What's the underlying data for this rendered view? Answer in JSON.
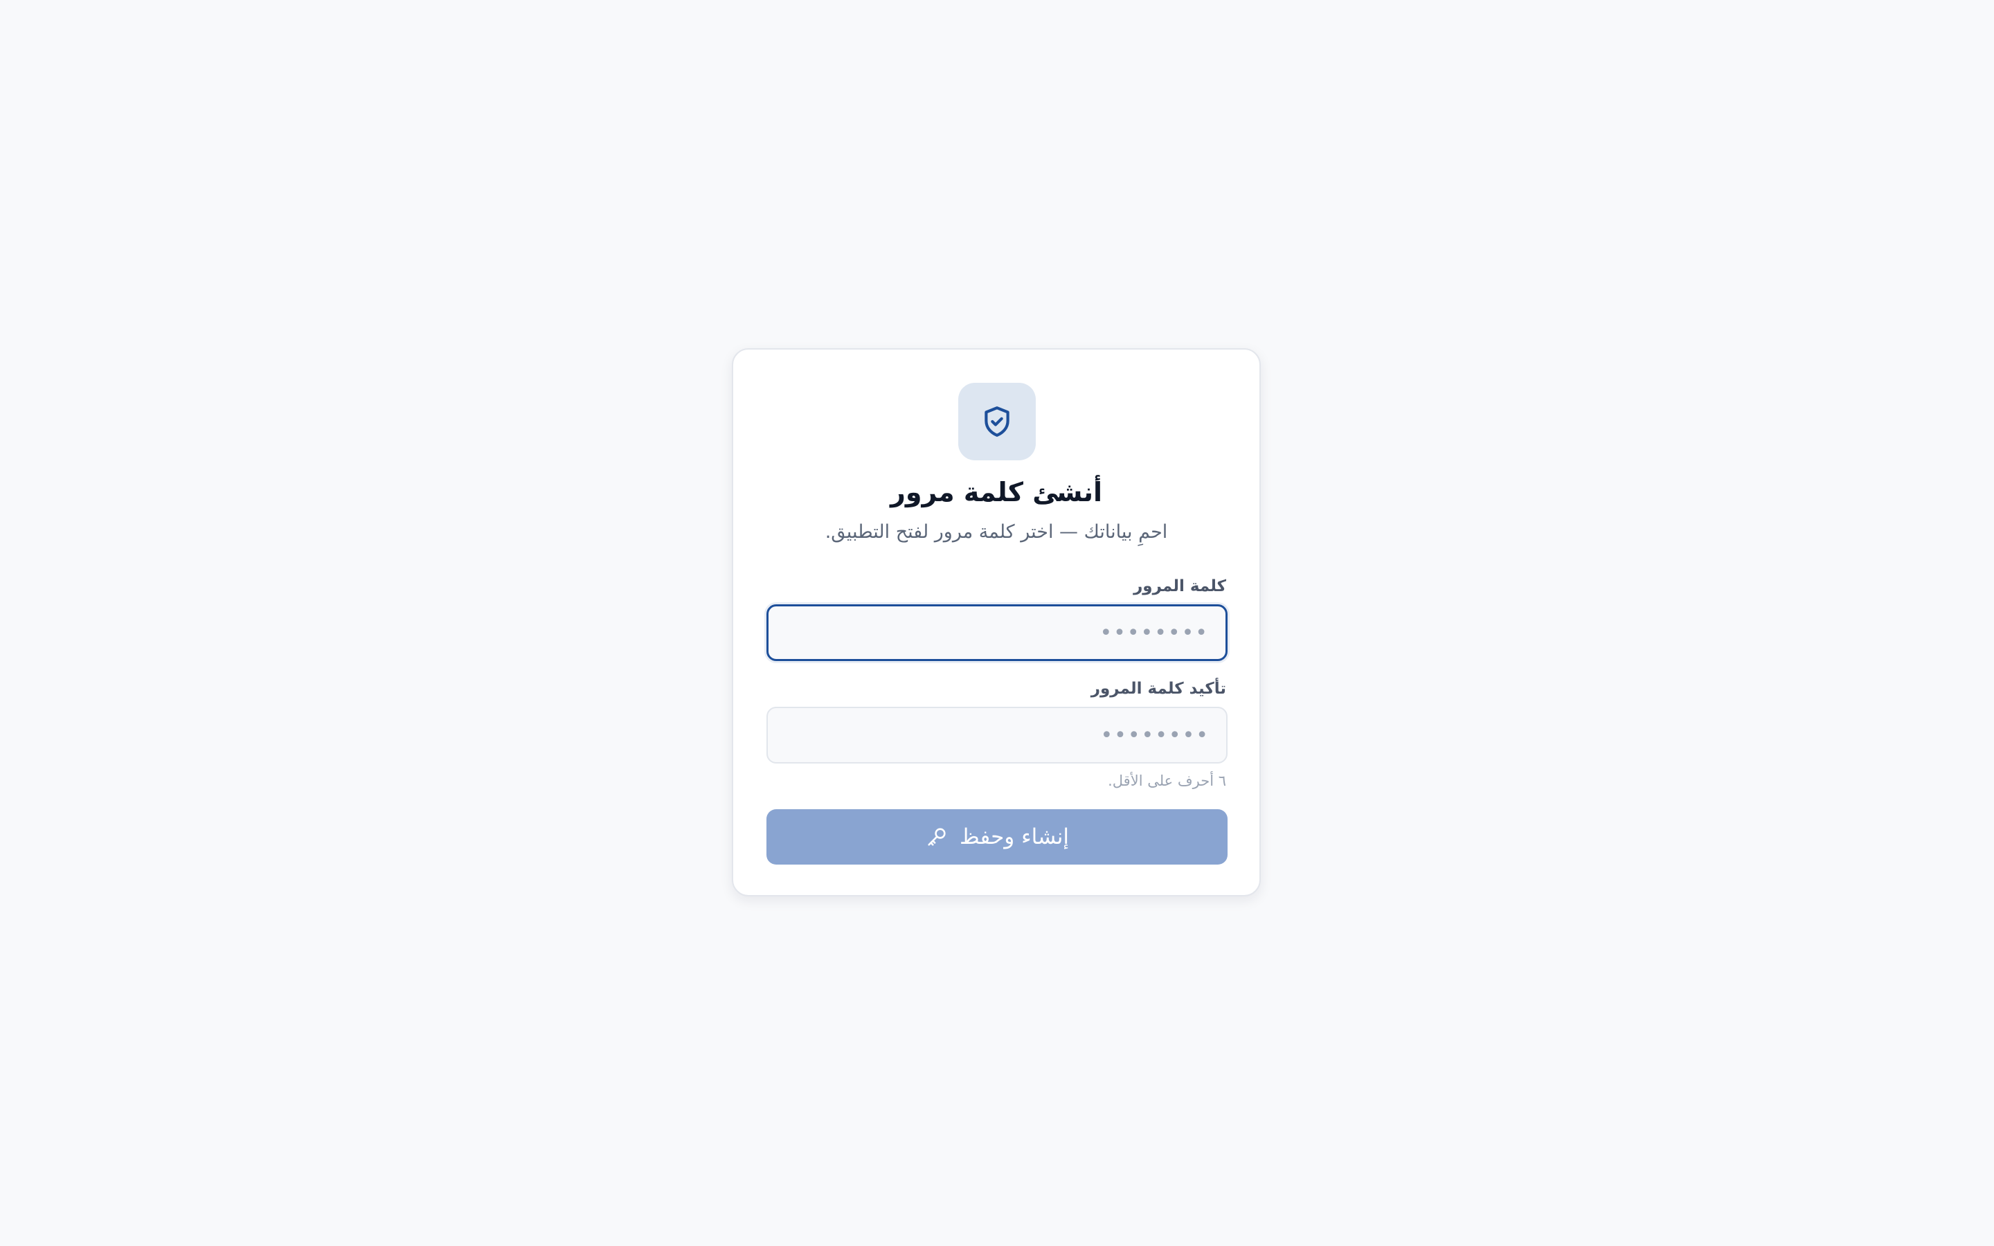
{
  "colors": {
    "background": "#f8f9fb",
    "accent": "#1d4f9a",
    "button_disabled": "#89a4d1",
    "icon_tile": "#dde6f1"
  },
  "header": {
    "icon": "shield-check-icon",
    "title": "أنشئ كلمة مرور",
    "subtitle": "احمِ بياناتك — اختر كلمة مرور لفتح التطبيق."
  },
  "form": {
    "password": {
      "label": "كلمة المرور",
      "placeholder": "••••••••",
      "value": ""
    },
    "confirm": {
      "label": "تأكيد كلمة المرور",
      "placeholder": "••••••••",
      "value": ""
    },
    "hint": "٦ أحرف على الأقل.",
    "submit": {
      "label": "إنشاء وحفظ",
      "icon": "key-icon"
    }
  }
}
